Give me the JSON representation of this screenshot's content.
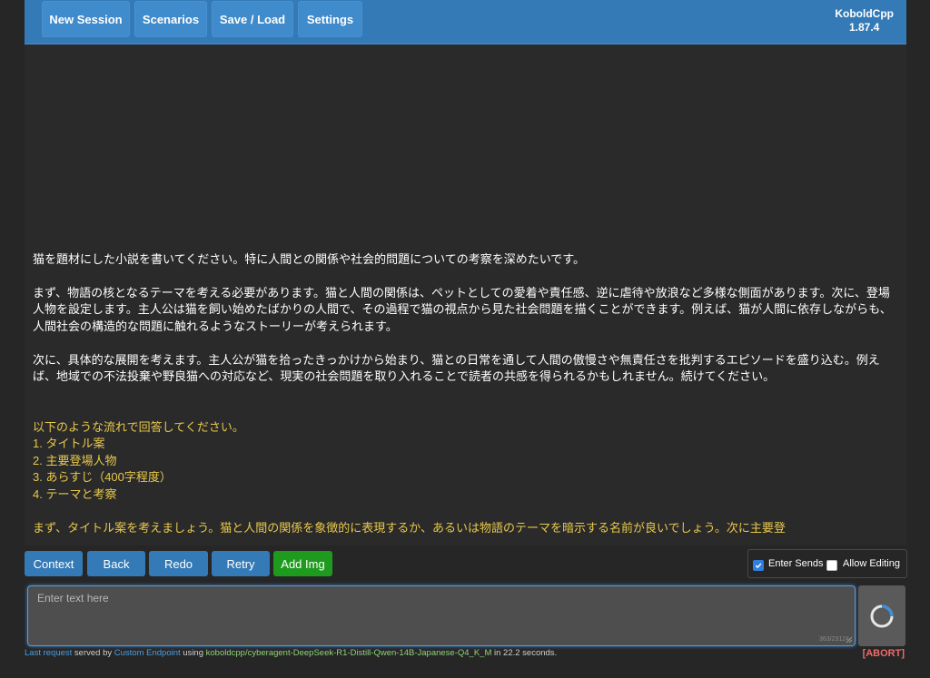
{
  "nav": {
    "new_session": "New Session",
    "scenarios": "Scenarios",
    "save_load": "Save / Load",
    "settings": "Settings",
    "brand_name": "KoboldCpp",
    "brand_version": "1.87.4"
  },
  "story": {
    "user_lines": [
      "猫を題材にした小説を書いてください。特に人間との関係や社会的問題についての考察を深めたいです。",
      "まず、物語の核となるテーマを考える必要があります。猫と人間の関係は、ペットとしての愛着や責任感、逆に虐待や放浪など多様な側面があります。次に、登場人物を設定します。主人公は猫を飼い始めたばかりの人間で、その過程で猫の視点から見た社会問題を描くことができます。例えば、猫が人間に依存しながらも、人間社会の構造的な問題に触れるようなストーリーが考えられます。",
      "次に、具体的な展開を考えます。主人公が猫を拾ったきっかけから始まり、猫との日常を通して人間の傲慢さや無責任さを批判するエピソードを盛り込む。例えば、地域での不法投棄や野良猫への対応など、現実の社会問題を取り入れることで読者の共感を得られるかもしれません。続けてください。"
    ],
    "ai_intro": "以下のような流れで回答してください。",
    "ai_list": [
      "1. タイトル案",
      "2. 主要登場人物",
      "3. あらすじ（400字程度）",
      "4. テーマと考察"
    ],
    "ai_last": "まず、タイトル案を考えましょう。猫と人間の関係を象徴的に表現するか、あるいは物語のテーマを暗示する名前が良いでしょう。次に主要登"
  },
  "controls": {
    "context": "Context",
    "back": "Back",
    "redo": "Redo",
    "retry": "Retry",
    "add_img": "Add Img",
    "enter_sends": "Enter Sends",
    "enter_sends_checked": true,
    "allow_editing": "Allow Editing",
    "allow_editing_checked": false
  },
  "input": {
    "placeholder": "Enter text here",
    "value": "",
    "counter": "363/23124"
  },
  "footer": {
    "last_request": "Last request",
    "served_by": " served by ",
    "endpoint": "Custom Endpoint",
    "using": " using ",
    "model": "koboldcpp/cyberagent-DeepSeek-R1-Distill-Qwen-14B-Japanese-Q4_K_M",
    "timing": " in 22.2 seconds.",
    "abort": "[ABORT]"
  },
  "colors": {
    "topbar": "#337ab7",
    "button": "#337ab7",
    "add_img": "#1e9a1e",
    "ai_text": "#e8c84a",
    "abort": "#f06a6a"
  }
}
